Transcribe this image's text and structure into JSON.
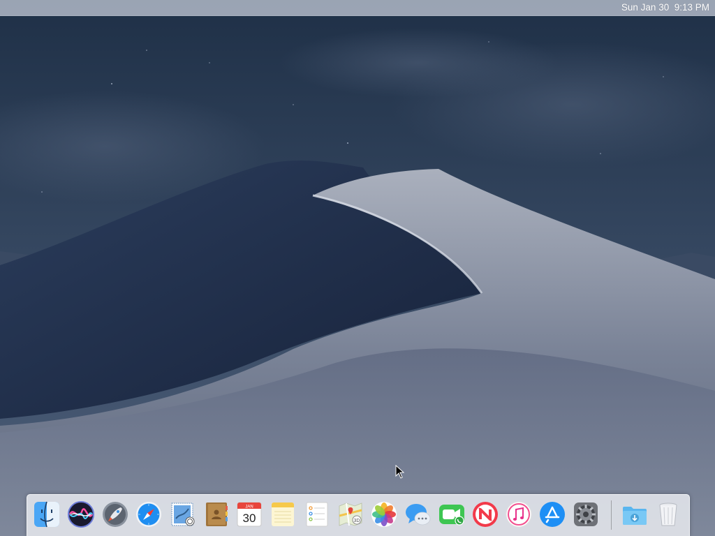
{
  "menubar": {
    "clock": "Sun Jan 30  9:13 PM"
  },
  "desktop": {
    "wallpaper": "macOS Mojave dark sand dune",
    "colors": {
      "sky_top": "#1f3047",
      "dune_light": "#a9afbd",
      "dune_shadow": "#1d2a45"
    }
  },
  "dock": {
    "apps": [
      {
        "id": "finder",
        "icon": "finder-icon",
        "running": true
      },
      {
        "id": "siri",
        "icon": "siri-icon"
      },
      {
        "id": "launchpad",
        "icon": "launchpad-rocket-icon"
      },
      {
        "id": "safari",
        "icon": "safari-compass-icon"
      },
      {
        "id": "mail",
        "icon": "mail-stamp-icon"
      },
      {
        "id": "contacts",
        "icon": "contacts-book-icon"
      },
      {
        "id": "calendar",
        "icon": "calendar-icon",
        "month": "JAN",
        "day": "30"
      },
      {
        "id": "notes",
        "icon": "notes-icon"
      },
      {
        "id": "reminders",
        "icon": "reminders-icon"
      },
      {
        "id": "maps",
        "icon": "maps-icon"
      },
      {
        "id": "photos",
        "icon": "photos-flower-icon"
      },
      {
        "id": "messages",
        "icon": "messages-bubble-icon"
      },
      {
        "id": "facetime",
        "icon": "facetime-camera-icon"
      },
      {
        "id": "news",
        "icon": "news-icon"
      },
      {
        "id": "itunes",
        "icon": "itunes-music-icon"
      },
      {
        "id": "app-store",
        "icon": "app-store-icon"
      },
      {
        "id": "system-preferences",
        "icon": "gear-icon"
      }
    ],
    "others": [
      {
        "id": "downloads",
        "icon": "downloads-folder-icon"
      },
      {
        "id": "trash",
        "icon": "trash-icon"
      }
    ]
  }
}
